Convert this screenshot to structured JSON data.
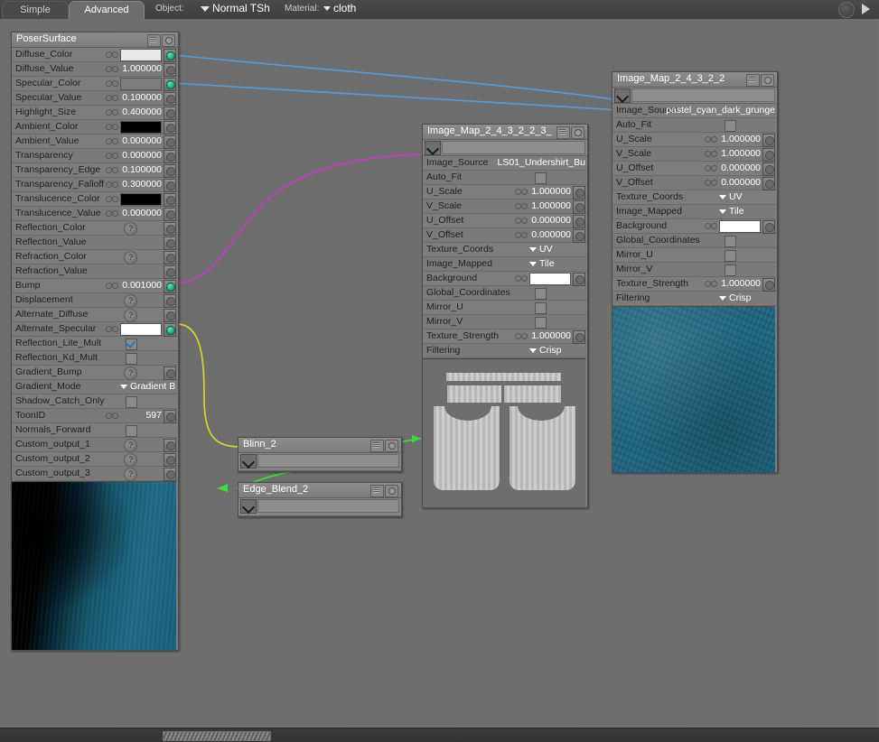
{
  "topbar": {
    "tabs": [
      {
        "label": "Simple",
        "active": false
      },
      {
        "label": "Advanced",
        "active": true
      }
    ],
    "object_label": "Object:",
    "object_value": "Normal TSh",
    "material_label": "Material:",
    "material_value": "cloth",
    "help_icon": "question-icon",
    "play_icon": "play-arrow-icon"
  },
  "nodes": {
    "poser_surface": {
      "title": "PoserSurface",
      "rows": [
        {
          "label": "Diffuse_Color",
          "type": "swatch",
          "color": "#e8e8e8",
          "link": true,
          "plug": "on"
        },
        {
          "label": "Diffuse_Value",
          "type": "number",
          "value": "1.000000",
          "link": true,
          "plug": "off"
        },
        {
          "label": "Specular_Color",
          "type": "swatch",
          "color": "#7d7d7d",
          "link": true,
          "plug": "on"
        },
        {
          "label": "Specular_Value",
          "type": "number",
          "value": "0.100000",
          "link": true,
          "plug": "off"
        },
        {
          "label": "Highlight_Size",
          "type": "number",
          "value": "0.400000",
          "link": true,
          "plug": "off"
        },
        {
          "label": "Ambient_Color",
          "type": "swatch",
          "color": "#000000",
          "link": true,
          "plug": "off"
        },
        {
          "label": "Ambient_Value",
          "type": "number",
          "value": "0.000000",
          "link": true,
          "plug": "off"
        },
        {
          "label": "Transparency",
          "type": "number",
          "value": "0.000000",
          "link": true,
          "plug": "off"
        },
        {
          "label": "Transparency_Edge",
          "type": "number",
          "value": "0.100000",
          "link": true,
          "plug": "off"
        },
        {
          "label": "Transparency_Falloff",
          "type": "number",
          "value": "0.300000",
          "link": true,
          "plug": "off"
        },
        {
          "label": "Translucence_Color",
          "type": "swatch",
          "color": "#000000",
          "link": true,
          "plug": "off"
        },
        {
          "label": "Translucence_Value",
          "type": "number",
          "value": "0.000000",
          "link": true,
          "plug": "off"
        },
        {
          "label": "Reflection_Color",
          "type": "qmark",
          "value": "?",
          "link": false,
          "plug": "off"
        },
        {
          "label": "Reflection_Value",
          "type": "blank",
          "value": "",
          "link": false,
          "plug": "off"
        },
        {
          "label": "Refraction_Color",
          "type": "qmark",
          "value": "?",
          "link": false,
          "plug": "off"
        },
        {
          "label": "Refraction_Value",
          "type": "blank",
          "value": "",
          "link": false,
          "plug": "off"
        },
        {
          "label": "Bump",
          "type": "number",
          "value": "0.001000",
          "link": true,
          "plug": "on"
        },
        {
          "label": "Displacement",
          "type": "qmark",
          "value": "?",
          "link": false,
          "plug": "off"
        },
        {
          "label": "Alternate_Diffuse",
          "type": "qmark",
          "value": "?",
          "link": false,
          "plug": "off"
        },
        {
          "label": "Alternate_Specular",
          "type": "swatch",
          "color": "#ffffff",
          "link": true,
          "plug": "on"
        },
        {
          "label": "Reflection_Lite_Mult",
          "type": "checkbox",
          "checked": true,
          "link": false,
          "plug": "none"
        },
        {
          "label": "Reflection_Kd_Mult",
          "type": "checkbox",
          "checked": false,
          "link": false,
          "plug": "none"
        },
        {
          "label": "Gradient_Bump",
          "type": "qmark",
          "value": "?",
          "link": false,
          "plug": "off"
        },
        {
          "label": "Gradient_Mode",
          "type": "dropdown",
          "value": "Gradient B",
          "link": false,
          "plug": "none"
        },
        {
          "label": "Shadow_Catch_Only",
          "type": "checkbox",
          "checked": false,
          "link": false,
          "plug": "none"
        },
        {
          "label": "ToonID",
          "type": "number",
          "value": "597",
          "link": true,
          "plug": "off"
        },
        {
          "label": "Normals_Forward",
          "type": "checkbox",
          "checked": false,
          "link": false,
          "plug": "none"
        },
        {
          "label": "Custom_output_1",
          "type": "qmark",
          "value": "?",
          "link": false,
          "plug": "off"
        },
        {
          "label": "Custom_output_2",
          "type": "qmark",
          "value": "?",
          "link": false,
          "plug": "off"
        },
        {
          "label": "Custom_output_3",
          "type": "qmark",
          "value": "?",
          "link": false,
          "plug": "off"
        }
      ],
      "preview_name": "render-preview-thumbnail"
    },
    "image_map_center": {
      "title": "Image_Map_2_4_3_2_2_3_",
      "rows": [
        {
          "label": "Image_Source",
          "type": "text",
          "value": "LS01_Undershirt_Bu",
          "link": false,
          "plug": "none"
        },
        {
          "label": "Auto_Fit",
          "type": "checkbox",
          "checked": false,
          "link": false,
          "plug": "none"
        },
        {
          "label": "U_Scale",
          "type": "number",
          "value": "1.000000",
          "link": true,
          "plug": "off"
        },
        {
          "label": "V_Scale",
          "type": "number",
          "value": "1.000000",
          "link": true,
          "plug": "off"
        },
        {
          "label": "U_Offset",
          "type": "number",
          "value": "0.000000",
          "link": true,
          "plug": "off"
        },
        {
          "label": "V_Offset",
          "type": "number",
          "value": "0.000000",
          "link": true,
          "plug": "off"
        },
        {
          "label": "Texture_Coords",
          "type": "dropdown",
          "value": "UV",
          "link": false,
          "plug": "none"
        },
        {
          "label": "Image_Mapped",
          "type": "dropdown",
          "value": "Tile",
          "link": false,
          "plug": "none"
        },
        {
          "label": "Background",
          "type": "swatch",
          "color": "#ffffff",
          "link": true,
          "plug": "off"
        },
        {
          "label": "Global_Coordinates",
          "type": "checkbox",
          "checked": false,
          "link": false,
          "plug": "none"
        },
        {
          "label": "Mirror_U",
          "type": "checkbox",
          "checked": false,
          "link": false,
          "plug": "none"
        },
        {
          "label": "Mirror_V",
          "type": "checkbox",
          "checked": false,
          "link": false,
          "plug": "none"
        },
        {
          "label": "Texture_Strength",
          "type": "number",
          "value": "1.000000",
          "link": true,
          "plug": "off"
        },
        {
          "label": "Filtering",
          "type": "dropdown",
          "value": "Crisp",
          "link": false,
          "plug": "none"
        }
      ],
      "preview_name": "undershirt-uv-preview"
    },
    "image_map_right": {
      "title": "Image_Map_2_4_3_2_2",
      "rows": [
        {
          "label": "Image_Source",
          "type": "text",
          "value": "pastel_cyan_dark_grunge",
          "link": false,
          "plug": "none"
        },
        {
          "label": "Auto_Fit",
          "type": "checkbox",
          "checked": false,
          "link": false,
          "plug": "none"
        },
        {
          "label": "U_Scale",
          "type": "number",
          "value": "1.000000",
          "link": true,
          "plug": "off"
        },
        {
          "label": "V_Scale",
          "type": "number",
          "value": "1.000000",
          "link": true,
          "plug": "off"
        },
        {
          "label": "U_Offset",
          "type": "number",
          "value": "0.000000",
          "link": true,
          "plug": "off"
        },
        {
          "label": "V_Offset",
          "type": "number",
          "value": "0.000000",
          "link": true,
          "plug": "off"
        },
        {
          "label": "Texture_Coords",
          "type": "dropdown",
          "value": "UV",
          "link": false,
          "plug": "none"
        },
        {
          "label": "Image_Mapped",
          "type": "dropdown",
          "value": "Tile",
          "link": false,
          "plug": "none"
        },
        {
          "label": "Background",
          "type": "swatch",
          "color": "#ffffff",
          "link": true,
          "plug": "off"
        },
        {
          "label": "Global_Coordinates",
          "type": "checkbox",
          "checked": false,
          "link": false,
          "plug": "none"
        },
        {
          "label": "Mirror_U",
          "type": "checkbox",
          "checked": false,
          "link": false,
          "plug": "none"
        },
        {
          "label": "Mirror_V",
          "type": "checkbox",
          "checked": false,
          "link": false,
          "plug": "none"
        },
        {
          "label": "Texture_Strength",
          "type": "number",
          "value": "1.000000",
          "link": true,
          "plug": "off"
        },
        {
          "label": "Filtering",
          "type": "dropdown",
          "value": "Crisp",
          "link": false,
          "plug": "none"
        }
      ],
      "preview_name": "cyan-grunge-preview"
    },
    "blinn": {
      "title": "Blinn_2"
    },
    "edge_blend": {
      "title": "Edge_Blend_2"
    }
  },
  "wire_colors": {
    "diffuse": "#5b9bd5",
    "specular": "#5b9bd5",
    "bump": "#c13fc1",
    "alternate_specular": "#d2d824",
    "node_out": "#3ddc3d"
  },
  "preview_colors": {
    "teal_texture": "#1d6580",
    "render_teal": "#17627d",
    "uv_background": "#6e6e6e",
    "uv_piece": "#c9c9c9"
  }
}
